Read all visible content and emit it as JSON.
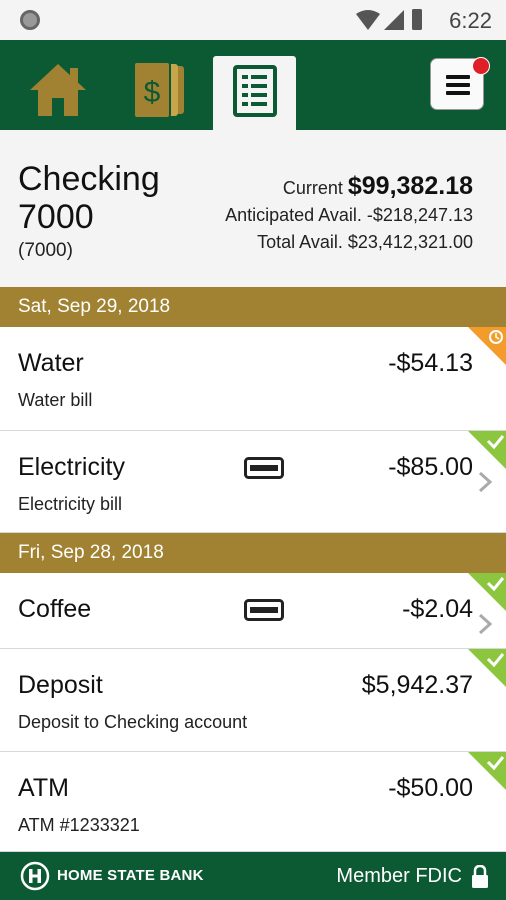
{
  "status_bar": {
    "time": "6:22"
  },
  "nav": {
    "tabs": [
      {
        "icon": "home-icon"
      },
      {
        "icon": "dollar-cards-icon"
      },
      {
        "icon": "statement-icon",
        "active": true
      }
    ],
    "menu_icon": "hamburger-menu-icon",
    "notification": true
  },
  "account": {
    "name": "Checking 7000",
    "number": "(7000)",
    "current_label": "Current",
    "current_value": "$99,382.18",
    "anticipated_label": "Anticipated Avail.",
    "anticipated_value": "-$218,247.13",
    "total_label": "Total Avail.",
    "total_value": "$23,412,321.00"
  },
  "groups": [
    {
      "date": "Sat, Sep 29, 2018",
      "transactions": [
        {
          "name": "Water",
          "desc": "Water bill",
          "amount": "-$54.13",
          "status": "pending"
        },
        {
          "name": "Electricity",
          "desc": "Electricity bill",
          "amount": "-$85.00",
          "status": "cleared",
          "card": true,
          "chevron": true
        }
      ]
    },
    {
      "date": "Fri, Sep 28, 2018",
      "transactions": [
        {
          "name": "Coffee",
          "desc": "",
          "amount": "-$2.04",
          "status": "cleared",
          "card": true,
          "chevron": true
        },
        {
          "name": "Deposit",
          "desc": "Deposit to Checking account",
          "amount": "$5,942.37",
          "status": "cleared"
        },
        {
          "name": "ATM",
          "desc": "ATM #1233321",
          "amount": "-$50.00",
          "status": "cleared"
        }
      ]
    }
  ],
  "footer": {
    "bank": "HOME STATE BANK",
    "fdic": "Member FDIC"
  },
  "colors": {
    "brand_green": "#0c5a33",
    "gold": "#a08232",
    "cleared": "#8cc63f",
    "pending": "#f39c2b",
    "notification": "#e02027"
  }
}
